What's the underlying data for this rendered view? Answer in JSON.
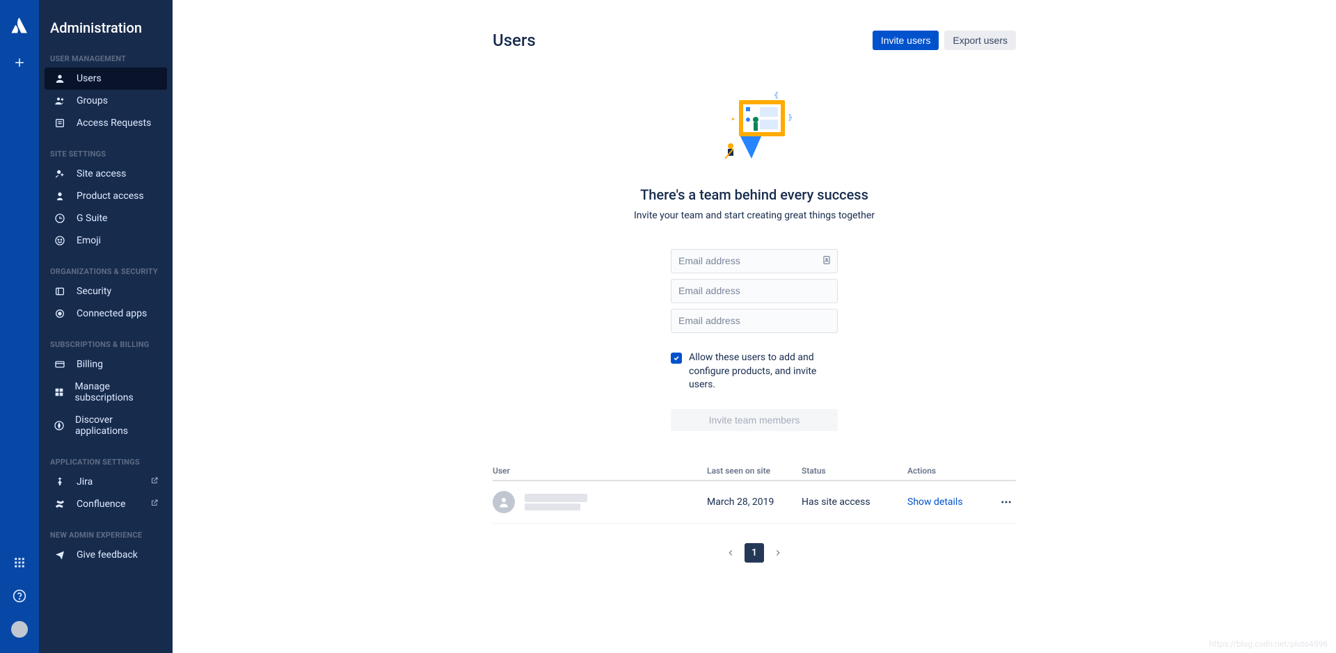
{
  "rail": {
    "logo": "atlassian-logo"
  },
  "sidebar": {
    "title": "Administration",
    "sections": [
      {
        "header": "USER MANAGEMENT",
        "items": [
          {
            "icon": "user-icon",
            "label": "Users",
            "active": true
          },
          {
            "icon": "group-icon",
            "label": "Groups"
          },
          {
            "icon": "request-icon",
            "label": "Access Requests"
          }
        ]
      },
      {
        "header": "SITE SETTINGS",
        "items": [
          {
            "icon": "site-access-icon",
            "label": "Site access"
          },
          {
            "icon": "product-access-icon",
            "label": "Product access"
          },
          {
            "icon": "gsuite-icon",
            "label": "G Suite"
          },
          {
            "icon": "emoji-icon",
            "label": "Emoji"
          }
        ]
      },
      {
        "header": "ORGANIZATIONS & SECURITY",
        "items": [
          {
            "icon": "security-icon",
            "label": "Security"
          },
          {
            "icon": "connected-apps-icon",
            "label": "Connected apps"
          }
        ]
      },
      {
        "header": "SUBSCRIPTIONS & BILLING",
        "items": [
          {
            "icon": "billing-icon",
            "label": "Billing"
          },
          {
            "icon": "manage-subs-icon",
            "label": "Manage subscriptions"
          },
          {
            "icon": "discover-apps-icon",
            "label": "Discover applications"
          }
        ]
      },
      {
        "header": "APPLICATION SETTINGS",
        "items": [
          {
            "icon": "jira-icon",
            "label": "Jira",
            "external": true
          },
          {
            "icon": "confluence-icon",
            "label": "Confluence",
            "external": true
          }
        ]
      },
      {
        "header": "NEW ADMIN EXPERIENCE",
        "items": [
          {
            "icon": "feedback-icon",
            "label": "Give feedback"
          }
        ]
      }
    ]
  },
  "page": {
    "title": "Users",
    "invite_users_btn": "Invite users",
    "export_users_btn": "Export users"
  },
  "hero": {
    "heading": "There's a team behind every success",
    "sub": "Invite your team and start creating great things together"
  },
  "invite": {
    "placeholder": "Email address",
    "checkbox_label": "Allow these users to add and configure products, and invite users.",
    "submit_label": "Invite team members"
  },
  "table": {
    "cols": {
      "user": "User",
      "last": "Last seen on site",
      "status": "Status",
      "actions": "Actions"
    },
    "rows": [
      {
        "name_redacted": true,
        "last_seen": "March 28, 2019",
        "status": "Has site access",
        "action_link": "Show details"
      }
    ]
  },
  "pagination": {
    "current": "1"
  },
  "watermark": "https://blog.csdn.net/pluto4596"
}
